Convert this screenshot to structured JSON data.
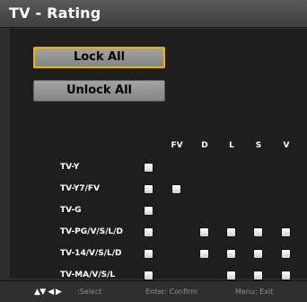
{
  "title": "TV - Rating",
  "buttons": {
    "lock_all": "Lock All",
    "unlock_all": "Unlock All"
  },
  "columns": [
    "FV",
    "D",
    "L",
    "S",
    "V"
  ],
  "rows": [
    {
      "label": "TV-Y",
      "cells": [
        true,
        false,
        false,
        false,
        false,
        false
      ]
    },
    {
      "label": "TV-Y7/FV",
      "cells": [
        true,
        true,
        false,
        false,
        false,
        false
      ]
    },
    {
      "label": "TV-G",
      "cells": [
        true,
        false,
        false,
        false,
        false,
        false
      ]
    },
    {
      "label": "TV-PG/V/S/L/D",
      "cells": [
        true,
        false,
        true,
        true,
        true,
        true
      ]
    },
    {
      "label": "TV-14/V/S/L/D",
      "cells": [
        true,
        false,
        true,
        true,
        true,
        true
      ]
    },
    {
      "label": "TV-MA/V/S/L",
      "cells": [
        true,
        false,
        false,
        true,
        true,
        true
      ]
    }
  ],
  "footer": {
    "nav_arrows": "▲▼ ◀ ▶",
    "select": ":Select",
    "confirm": "Enter: Confirm",
    "exit": "Menu: Exit"
  },
  "colors": {
    "focus_border": "#f0b100",
    "button_fill": "#959595",
    "background": "#1e1e1e"
  }
}
